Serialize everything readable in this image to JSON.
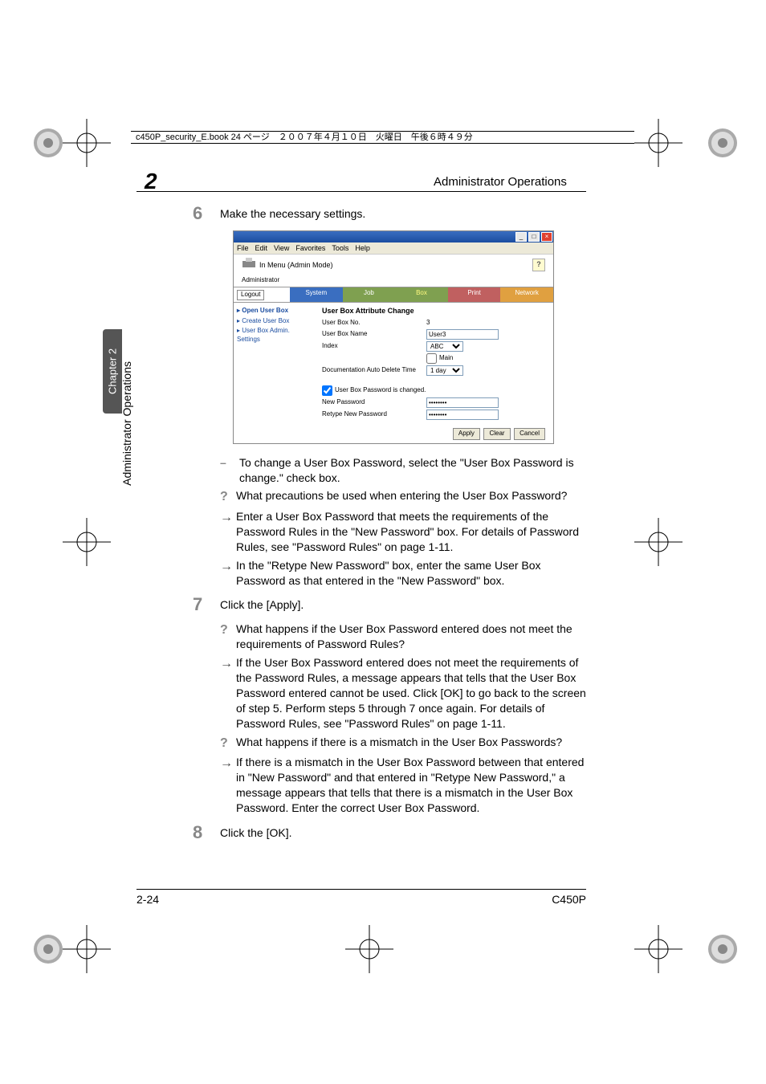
{
  "header_bar": "c450P_security_E.book  24 ページ　２００７年４月１０日　火曜日　午後６時４９分",
  "running_head": "Administrator Operations",
  "chapter_number": "2",
  "side_tab": "Chapter 2",
  "side_text": "Administrator Operations",
  "footer": {
    "left": "2-24",
    "right": "C450P"
  },
  "steps": {
    "s6": {
      "num": "6",
      "text": "Make the necessary settings."
    },
    "s7": {
      "num": "7",
      "text": "Click the [Apply]."
    },
    "s8": {
      "num": "8",
      "text": "Click the [OK]."
    }
  },
  "subs": {
    "a": "To change a User Box Password, select the \"User Box Password is change.\" check box.",
    "b": "What precautions be used when entering the User Box Password?",
    "c": "Enter a User Box Password that meets the requirements of the Password Rules in the \"New Password\" box. For details of Password Rules, see \"Password Rules\" on page 1-11.",
    "d": "In the \"Retype New Password\" box, enter the same User Box Password as that entered in the \"New Password\" box.",
    "e": "What happens if the User Box Password entered does not meet the requirements of Password Rules?",
    "f": "If the User Box Password entered does not meet the requirements of the Password Rules, a message appears that tells that the User Box Password entered cannot be used. Click [OK] to go back to the screen of step 5. Perform steps 5 through 7 once again. For details of Password Rules, see \"Password Rules\" on page 1-11.",
    "g": "What happens if there is a mismatch in the User Box Passwords?",
    "h": "If there is a mismatch in the User Box Password between that entered in \"New Password\" and that entered in \"Retype New Password,\" a message appears that tells that there is a mismatch in the User Box Password. Enter the correct User Box Password."
  },
  "ss": {
    "menus": {
      "file": "File",
      "edit": "Edit",
      "view": "View",
      "fav": "Favorites",
      "tools": "Tools",
      "help": "Help"
    },
    "banner_text": "In Menu (Admin Mode)",
    "admin_label": "Administrator",
    "logout": "Logout",
    "tabs": {
      "system": "System",
      "job": "Job",
      "box": "Box",
      "print": "Print",
      "network": "Network"
    },
    "side": {
      "open": "Open User Box",
      "create": "Create User Box",
      "admin": "User Box Admin. Settings"
    },
    "main": {
      "heading": "User Box Attribute Change",
      "rows": {
        "no": {
          "label": "User Box No.",
          "value": "3"
        },
        "name": {
          "label": "User Box Name",
          "value": "User3"
        },
        "index": {
          "label": "Index",
          "value": "ABC"
        },
        "main_chk": "Main",
        "autodel": {
          "label": "Documentation Auto Delete Time",
          "value": "1 day"
        },
        "pwdchg": "User Box Password is changed.",
        "newpw": {
          "label": "New Password",
          "value": "••••••••"
        },
        "repw": {
          "label": "Retype New Password",
          "value": "••••••••"
        }
      },
      "buttons": {
        "apply": "Apply",
        "clear": "Clear",
        "cancel": "Cancel"
      }
    }
  }
}
